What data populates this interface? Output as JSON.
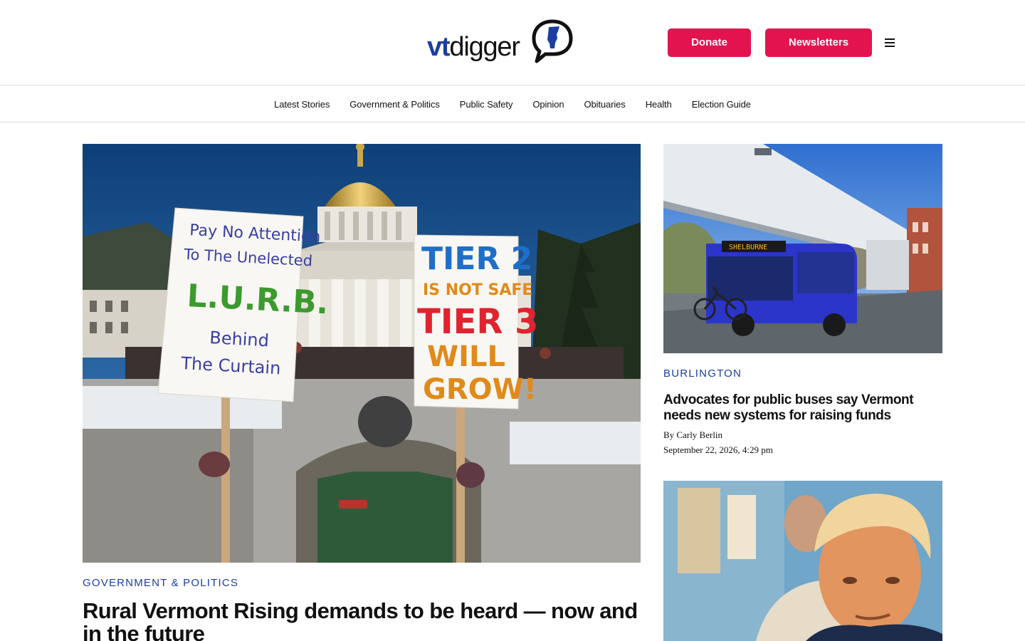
{
  "header": {
    "logo_vt": "vt",
    "logo_digger": "digger",
    "donate_label": "Donate",
    "newsletters_label": "Newsletters",
    "menu_icon": "hamburger-menu-icon",
    "brand_color": "#1c3ea0",
    "button_color": "#e3134f"
  },
  "nav": {
    "items": [
      {
        "label": "Latest Stories"
      },
      {
        "label": "Government & Politics"
      },
      {
        "label": "Public Safety"
      },
      {
        "label": "Opinion"
      },
      {
        "label": "Obituaries"
      },
      {
        "label": "Health"
      },
      {
        "label": "Election Guide"
      }
    ]
  },
  "lead_story": {
    "category": "GOVERNMENT & POLITICS",
    "headline": "Rural Vermont Rising demands to be heard — now and in the future",
    "image": {
      "sign_left_lines": [
        "Pay No Attention",
        "To The Unelected",
        "L.U.R.B.",
        "Behind",
        "The Curtain"
      ],
      "sign_right_lines": [
        "TIER 2",
        "IS NOT SAFE",
        "TIER 3",
        "WILL",
        "GROW!"
      ]
    }
  },
  "side_stories": [
    {
      "category": "BURLINGTON",
      "headline": "Advocates for public buses say Vermont needs new systems for raising funds",
      "byline_prefix": "By ",
      "author": "Carly Berlin",
      "date": "September 22, 2026, 4:29 pm",
      "image": {
        "bus_sign": "SHELBURNE"
      }
    },
    {
      "category": "",
      "headline": "",
      "image": {}
    }
  ]
}
